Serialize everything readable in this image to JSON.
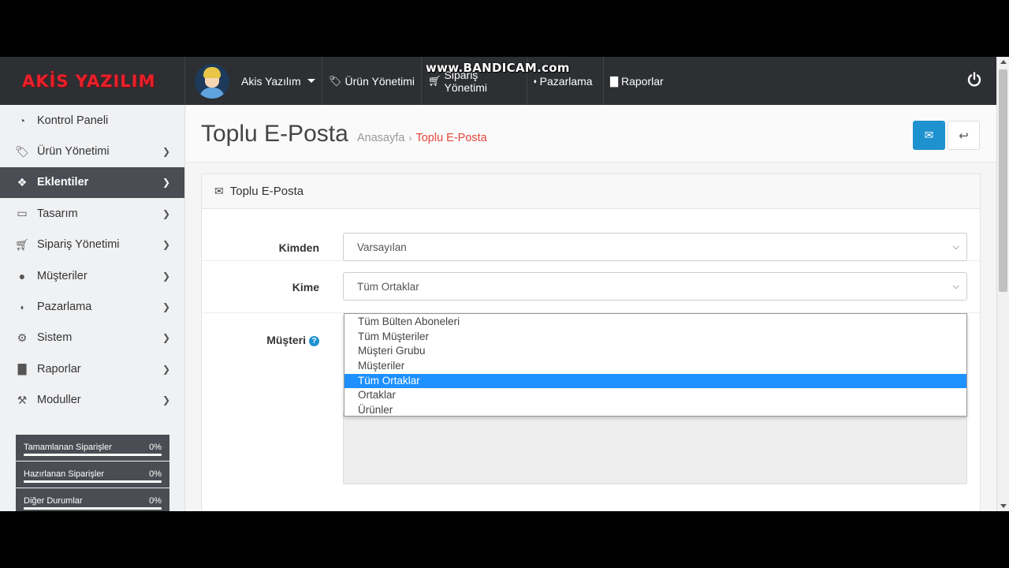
{
  "brand": {
    "logo_text": "AKİS YAZILIM"
  },
  "watermark": "www.BANDICAM.com",
  "topbar": {
    "user_name": "Akis Yazılım",
    "nav": [
      {
        "label": "Ürün Yönetimi",
        "icon": "tags-icon"
      },
      {
        "label": "Sipariş Yönetimi",
        "icon": "cart-icon"
      },
      {
        "label": "Pazarlama",
        "icon": "share-icon"
      },
      {
        "label": "Raporlar",
        "icon": "bar-chart-icon"
      }
    ],
    "power_icon": "power-icon"
  },
  "sidebar": {
    "items": [
      {
        "label": "Kontrol Paneli",
        "icon": "dashboard-icon"
      },
      {
        "label": "Ürün Yönetimi",
        "icon": "tags-icon"
      },
      {
        "label": "Eklentiler",
        "icon": "puzzle-icon"
      },
      {
        "label": "Tasarım",
        "icon": "desktop-icon"
      },
      {
        "label": "Sipariş Yönetimi",
        "icon": "cart-icon"
      },
      {
        "label": "Müşteriler",
        "icon": "user-icon"
      },
      {
        "label": "Pazarlama",
        "icon": "share-icon"
      },
      {
        "label": "Sistem",
        "icon": "cog-icon"
      },
      {
        "label": "Raporlar",
        "icon": "bar-chart-icon"
      },
      {
        "label": "Moduller",
        "icon": "plug-icon"
      }
    ],
    "active_index": 2,
    "stats": [
      {
        "label": "Tamamlanan Siparişler",
        "value": "0%"
      },
      {
        "label": "Hazırlanan Siparişler",
        "value": "0%"
      },
      {
        "label": "Diğer Durumlar",
        "value": "0%"
      }
    ]
  },
  "page": {
    "title": "Toplu E-Posta",
    "breadcrumb": [
      "Anasayfa",
      "Toplu E-Posta"
    ]
  },
  "panel": {
    "title": "Toplu E-Posta",
    "from_label": "Kimden",
    "from_value": "Varsayılan",
    "to_label": "Kime",
    "to_value": "Tüm Ortaklar",
    "customer_label": "Müşteri",
    "to_options": [
      "Tüm Bülten Aboneleri",
      "Tüm Müşteriler",
      "Müşteri Grubu",
      "Müşteriler",
      "Tüm Ortaklar",
      "Ortaklar",
      "Ürünler"
    ],
    "to_selected_index": 4
  },
  "colors": {
    "brand_red": "#e8202a",
    "topbar_bg": "#2d2f33",
    "accent_blue": "#1e91cf",
    "breadcrumb_active": "#e3463a",
    "select_highlight": "#1e90ff"
  }
}
